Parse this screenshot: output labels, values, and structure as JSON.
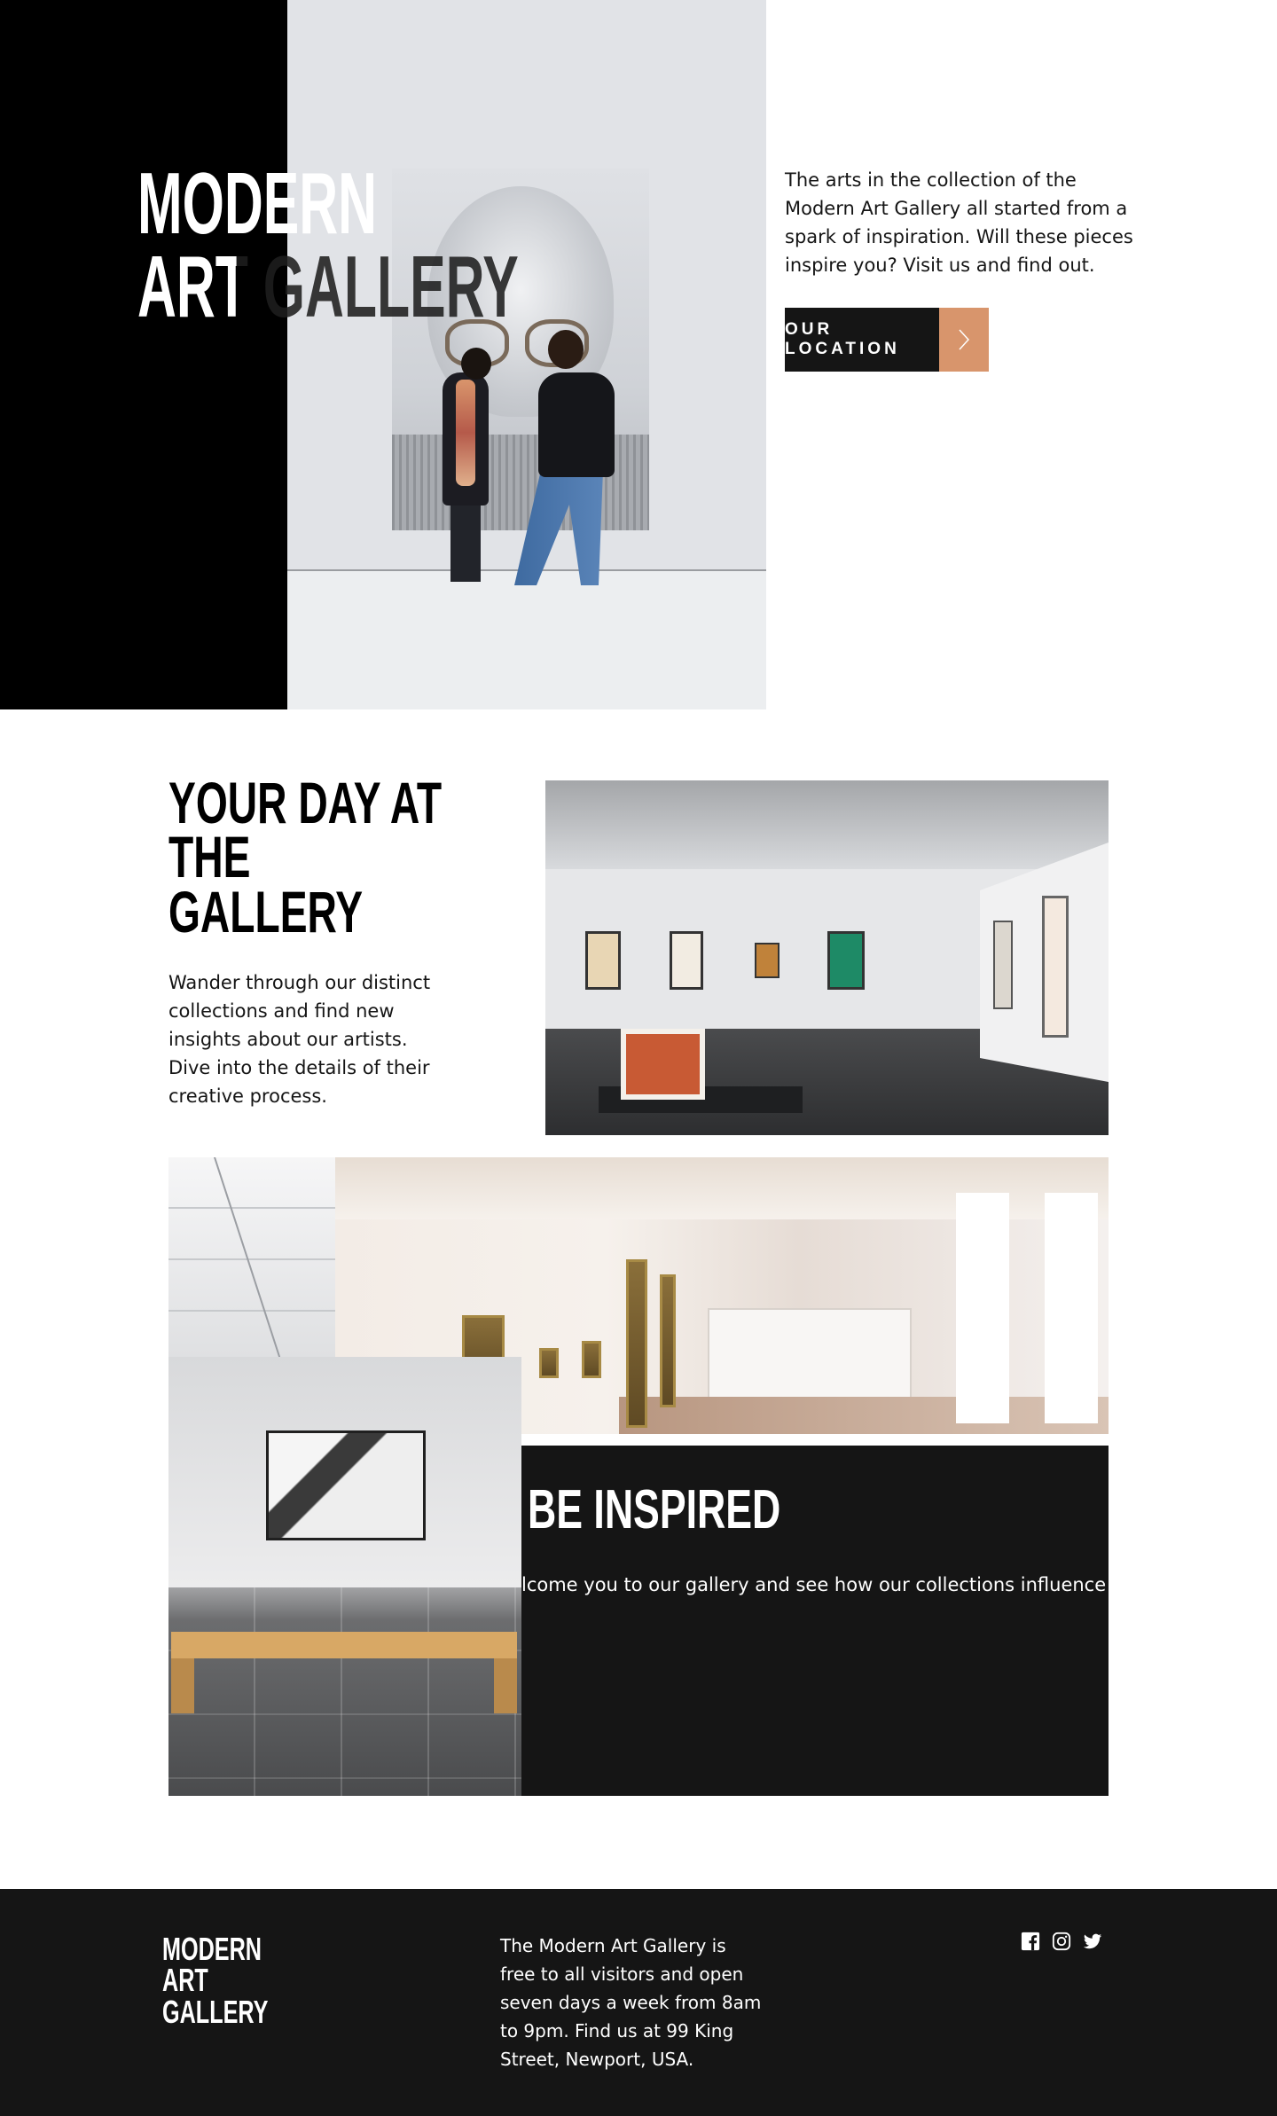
{
  "hero": {
    "title_line1": "MODERN",
    "title_line2": "ART GALLERY",
    "intro": "The arts in the collection of the Modern Art Gallery all started from a spark of inspiration. Will these pieces inspire you? Visit us and find out.",
    "cta_label": "OUR LOCATION",
    "cta_icon": "chevron-right-icon"
  },
  "day": {
    "heading_line1": "YOUR DAY AT",
    "heading_line2": "THE",
    "heading_line3": "GALLERY",
    "text": "Wander through our distinct collections and find new insights about our artists. Dive into the details of their creative process."
  },
  "inspire": {
    "heading": "BE INSPIRED",
    "text": "lcome you to our gallery and see how our collections influence you."
  },
  "footer": {
    "logo_line1": "MODERN",
    "logo_line2": "ART",
    "logo_line3": "GALLERY",
    "text": "The Modern Art Gallery is free to all visitors and open seven days a week from 8am to 9pm. Find us at 99 King Street, Newport, USA.",
    "social_icons": [
      "facebook-icon",
      "instagram-icon",
      "twitter-icon"
    ]
  },
  "colors": {
    "black": "#000000",
    "dark": "#151515",
    "accent": "#d8956c",
    "white": "#ffffff"
  }
}
